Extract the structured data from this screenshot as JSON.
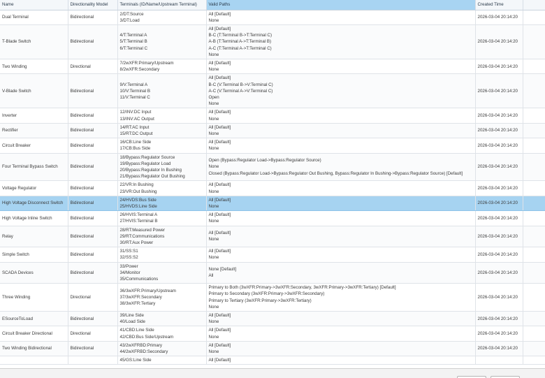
{
  "columns": [
    "Name",
    "Directionality Model",
    "Terminals (ID/Name/Upstream Terminal)",
    "Valid Paths",
    "Created Time",
    ""
  ],
  "sorted_column": 3,
  "selected_row": 9,
  "rows": [
    {
      "name": "Dual Terminal",
      "dir": "Bidirectional",
      "terminals": [
        "2/DT:Source",
        "3/DT:Load"
      ],
      "paths": [
        "All [Default]",
        "None"
      ],
      "created": "2026-03-04 20:14:20"
    },
    {
      "name": "T-Blade Switch",
      "dir": "Bidirectional",
      "terminals": [
        "4/T:Terminal A",
        "5/T:Terminal B",
        "6/T:Terminal C"
      ],
      "paths": [
        "All [Default]",
        "B-C (T:Terminal B->T:Terminal C)",
        "A-B (T:Terminal A->T:Terminal B)",
        "A-C (T:Terminal A->T:Terminal C)",
        "None"
      ],
      "created": "2026-03-04 20:14:20"
    },
    {
      "name": "Two Winding",
      "dir": "Directional",
      "terminals": [
        "7/2wXFR:Primary/Upstream",
        "8/2wXFR:Secondary"
      ],
      "paths": [
        "All [Default]",
        "None"
      ],
      "created": "2026-03-04 20:14:20"
    },
    {
      "name": "V-Blade Switch",
      "dir": "Bidirectional",
      "terminals": [
        "9/V:Terminal A",
        "10/V:Terminal B",
        "11/V:Terminal C"
      ],
      "paths": [
        "All [Default]",
        "B-C (V:Terminal B->V:Terminal C)",
        "A-C (V:Terminal A->V:Terminal C)",
        "Open",
        "None"
      ],
      "created": "2026-03-04 20:14:20"
    },
    {
      "name": "Inverter",
      "dir": "Bidirectional",
      "terminals": [
        "12/INV:DC Input",
        "13/INV:AC Output"
      ],
      "paths": [
        "All [Default]",
        "None"
      ],
      "created": "2026-03-04 20:14:20"
    },
    {
      "name": "Rectifier",
      "dir": "Bidirectional",
      "terminals": [
        "14/RT:AC Input",
        "15/RT:DC Output"
      ],
      "paths": [
        "All [Default]",
        "None"
      ],
      "created": "2026-03-04 20:14:20"
    },
    {
      "name": "Circuit Breaker",
      "dir": "Bidirectional",
      "terminals": [
        "16/CB:Line Side",
        "17/CB:Bus Side"
      ],
      "paths": [
        "All [Default]",
        "None"
      ],
      "created": "2026-03-04 20:14:20"
    },
    {
      "name": "Four Terminal Bypass Switch",
      "dir": "Bidirectional",
      "terminals": [
        "18/Bypass:Regulator Source",
        "19/Bypass:Regulator Load",
        "20/Bypass:Regulator In Bushing",
        "21/Bypass:Regulator Out Bushing"
      ],
      "paths": [
        "Open (Bypass:Regulator Load->Bypass:Regulator Source)",
        "None",
        "Closed (Bypass:Regulator Load->Bypass:Regulator Out Bushing, Bypass:Regulator In Bushing->Bypass:Regulator Source) [Default]"
      ],
      "created": "2026-03-04 20:14:20"
    },
    {
      "name": "Voltage Regulator",
      "dir": "Bidirectional",
      "terminals": [
        "22/VR:In Bushing",
        "23/VR:Out Bushing"
      ],
      "paths": [
        "All [Default]",
        "None"
      ],
      "created": "2026-03-04 20:14:20"
    },
    {
      "name": "High Voltage Disconnect Switch",
      "dir": "Bidirectional",
      "terminals": [
        "24/HVDS:Bus Side",
        "25/HVDS:Line Side"
      ],
      "paths": [
        "All [Default]",
        "None"
      ],
      "created": "2026-03-04 20:14:20"
    },
    {
      "name": "High Voltage Inline Switch",
      "dir": "Bidirectional",
      "terminals": [
        "26/HVIS:Terminal A",
        "27/HVIS:Terminal B"
      ],
      "paths": [
        "All [Default]",
        "None"
      ],
      "created": "2026-03-04 20:14:20"
    },
    {
      "name": "Relay",
      "dir": "Bidirectional",
      "terminals": [
        "28/RT:Measured Power",
        "29/RT:Communications",
        "30/RT:Aux Power"
      ],
      "paths": [
        "All [Default]",
        "None"
      ],
      "created": "2026-03-04 20:14:20"
    },
    {
      "name": "Simple Switch",
      "dir": "Bidirectional",
      "terminals": [
        "31/SS:S1",
        "32/SS:S2"
      ],
      "paths": [
        "All [Default]",
        "None"
      ],
      "created": "2026-03-04 20:14:20"
    },
    {
      "name": "SCADA Devices",
      "dir": "Bidirectional",
      "terminals": [
        "33/Power",
        "34/Monitor",
        "35/Communications"
      ],
      "paths": [
        "None [Default]",
        "All"
      ],
      "created": "2026-03-04 20:14:20"
    },
    {
      "name": "Three Winding",
      "dir": "Directional",
      "terminals": [
        "36/3wXFR:Primary/Upstream",
        "37/3wXFR:Secondary",
        "38/3wXFR:Tertiary"
      ],
      "paths": [
        "Primary to Both (3wXFR:Primary->3wXFR:Secondary, 3wXFR:Primary->3wXFR:Tertiary) [Default]",
        "Primary to Secondary (3wXFR:Primary->3wXFR:Secondary)",
        "Primary to Tertiary (3wXFR:Primary->3wXFR:Tertiary)",
        "None"
      ],
      "created": "2026-03-04 20:14:20"
    },
    {
      "name": "ESourceToLoad",
      "dir": "Bidirectional",
      "terminals": [
        "39/Line Side",
        "40/Load Side"
      ],
      "paths": [
        "All [Default]",
        "None"
      ],
      "created": "2026-03-04 20:14:20"
    },
    {
      "name": "Circuit Breaker Directional",
      "dir": "Directional",
      "terminals": [
        "41/CBD:Line Side",
        "42/CBD:Bus Side/Upstream"
      ],
      "paths": [
        "All [Default]",
        "None"
      ],
      "created": "2026-03-04 20:14:20"
    },
    {
      "name": "Two Winding Bidirectional",
      "dir": "Bidirectional",
      "terminals": [
        "43/2wXFRBD:Primary",
        "44/2wXFRBD:Secondary"
      ],
      "paths": [
        "All [Default]",
        "None"
      ],
      "created": "2026-03-04 20:14:20"
    },
    {
      "name": "",
      "dir": "",
      "terminals": [
        "45/GS:Line Side"
      ],
      "paths": [
        "All [Default]"
      ],
      "created": ""
    }
  ]
}
